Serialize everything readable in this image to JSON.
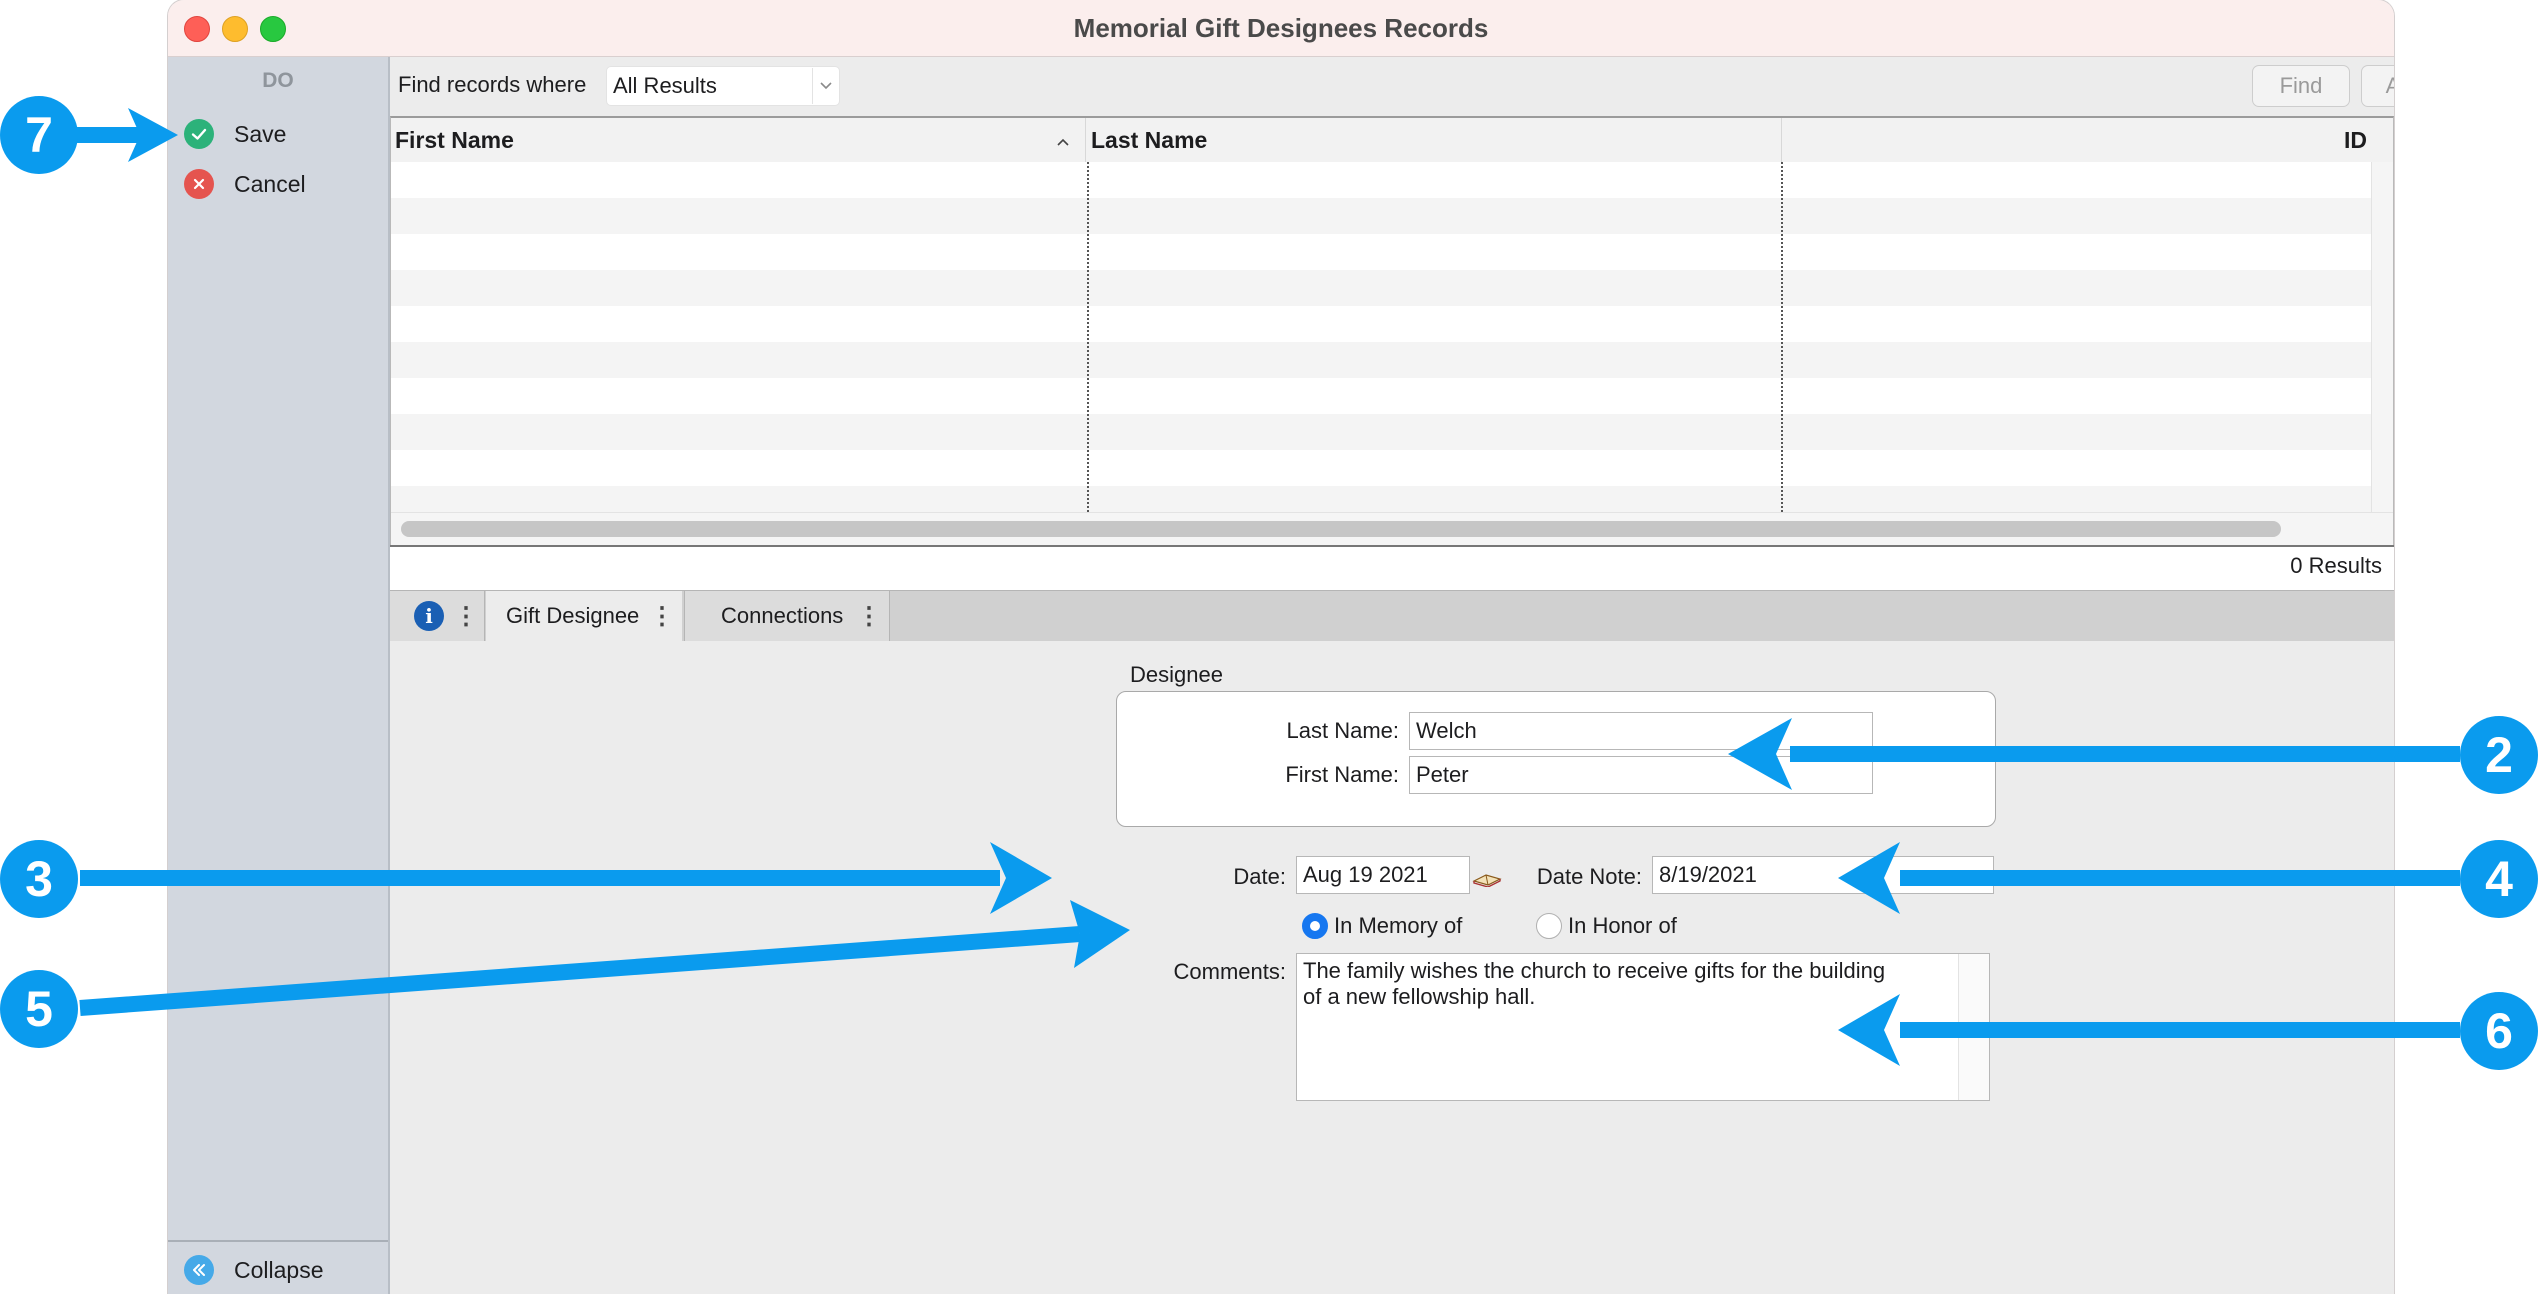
{
  "window": {
    "title": "Memorial Gift Designees Records"
  },
  "sidebar": {
    "header": "DO",
    "items": [
      {
        "label": "Save",
        "icon": "checkmark-icon",
        "color": "#2cb27a"
      },
      {
        "label": "Cancel",
        "icon": "x-icon",
        "color": "#e5544f"
      }
    ],
    "collapse_label": "Collapse"
  },
  "findbar": {
    "label": "Find records where",
    "select_value": "All Results",
    "find_button": "Find",
    "advanced_find_button": "Advanced Find"
  },
  "table": {
    "columns": [
      "First Name",
      "Last Name",
      "ID"
    ],
    "rows": []
  },
  "results": {
    "text": "0 Results"
  },
  "tabs": [
    {
      "label": "Gift Designee"
    },
    {
      "label": "Connections"
    }
  ],
  "form": {
    "group_title": "Designee",
    "last_name_label": "Last Name:",
    "last_name_value": "Welch",
    "first_name_label": "First Name:",
    "first_name_value": "Peter",
    "date_label": "Date:",
    "date_value": "Aug 19 2021",
    "date_note_label": "Date Note:",
    "date_note_value": "8/19/2021",
    "radio_memory_label": "In Memory of",
    "radio_honor_label": "In Honor of",
    "radio_selected": "In Memory of",
    "comments_label": "Comments:",
    "comments_value": "The family wishes the church to receive gifts for the building\nof a new fellowship hall."
  },
  "callouts": [
    "7",
    "2",
    "3",
    "4",
    "5",
    "6"
  ],
  "colors": {
    "accent": "#0a9bee",
    "radio_selected": "#1677f0"
  }
}
